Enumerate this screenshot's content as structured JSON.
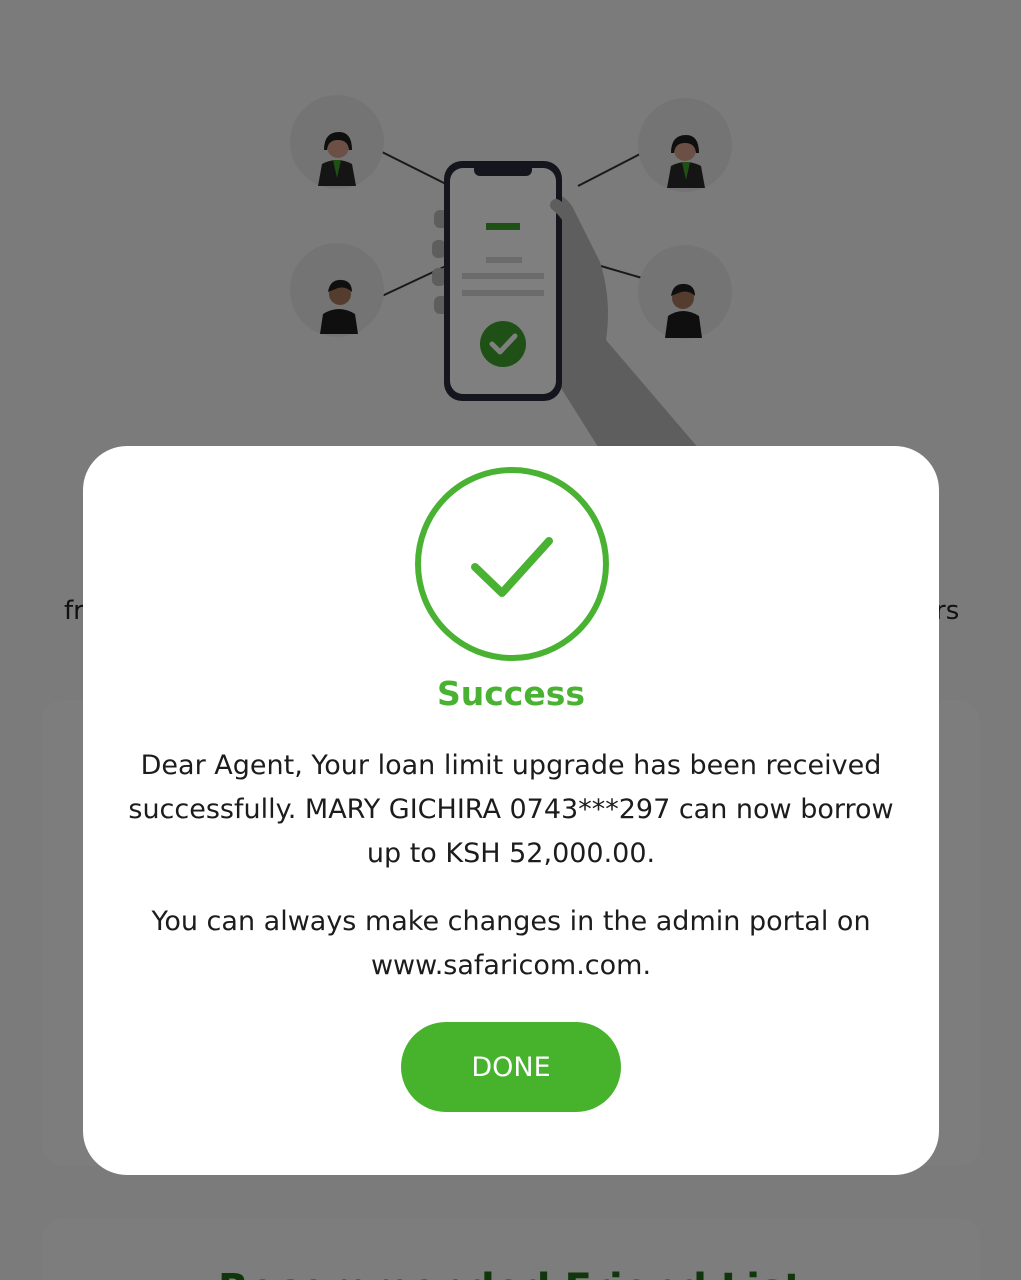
{
  "background": {
    "left_snippet": "fr",
    "right_snippet": "rs",
    "card2_title": "Recommended Friend List"
  },
  "modal": {
    "icon": "checkmark-circle-icon",
    "title": "Success",
    "message": "Dear Agent, Your loan limit upgrade has been received successfully. MARY GICHIRA 0743***297 can now borrow up to KSH 52,000.00.",
    "note": "You can always make changes in the admin portal on www.safaricom.com.",
    "done_label": "DONE"
  },
  "colors": {
    "accent_green": "#47b22c",
    "dark_green": "#1e6e17",
    "overlay": "rgba(0,0,0,0.5)"
  }
}
